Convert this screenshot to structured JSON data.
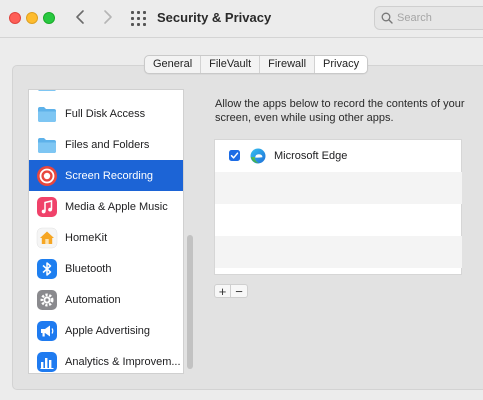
{
  "window": {
    "title": "Security & Privacy"
  },
  "search": {
    "placeholder": "Search"
  },
  "tabs": [
    {
      "label": "General",
      "selected": false
    },
    {
      "label": "FileVault",
      "selected": false
    },
    {
      "label": "Firewall",
      "selected": false
    },
    {
      "label": "Privacy",
      "selected": true
    }
  ],
  "sidebar": {
    "items": [
      {
        "label": "Full Disk Access",
        "icon": "folder-icon",
        "selected": false
      },
      {
        "label": "Files and Folders",
        "icon": "folder-icon",
        "selected": false
      },
      {
        "label": "Screen Recording",
        "icon": "screen-recording-icon",
        "selected": true
      },
      {
        "label": "Media & Apple Music",
        "icon": "music-icon",
        "selected": false
      },
      {
        "label": "HomeKit",
        "icon": "home-icon",
        "selected": false
      },
      {
        "label": "Bluetooth",
        "icon": "bluetooth-icon",
        "selected": false
      },
      {
        "label": "Automation",
        "icon": "gear-icon",
        "selected": false
      },
      {
        "label": "Apple Advertising",
        "icon": "advertising-icon",
        "selected": false
      },
      {
        "label": "Analytics & Improvem...",
        "icon": "analytics-icon",
        "selected": false
      }
    ]
  },
  "content": {
    "description": "Allow the apps below to record the contents of your screen, even while using other apps.",
    "apps": [
      {
        "name": "Microsoft Edge",
        "checked": true,
        "icon": "edge-icon"
      }
    ]
  },
  "buttons": {
    "add": "+",
    "remove": "−"
  },
  "colors": {
    "selection": "#1c64d6",
    "checkbox": "#1c6ce5",
    "close": "#fe5f57",
    "minimize": "#febc2e",
    "maximize": "#28c840"
  }
}
